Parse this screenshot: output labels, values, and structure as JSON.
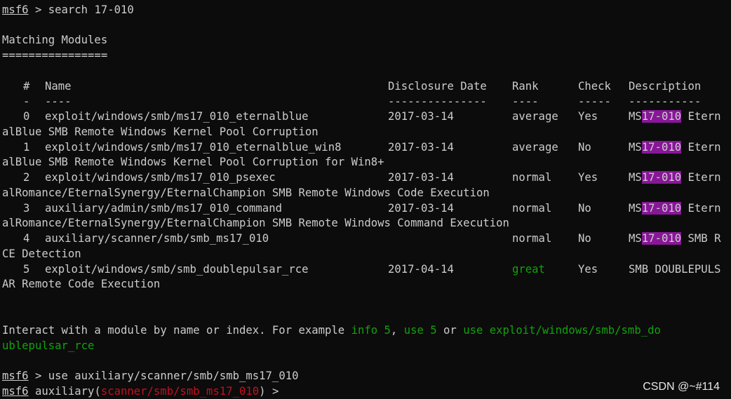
{
  "prompt": {
    "label": "msf6",
    "sep": " > "
  },
  "cmd1": "search 17-010",
  "heading": "Matching Modules",
  "underline": "================",
  "columns": {
    "num": "#",
    "name": "Name",
    "date": "Disclosure Date",
    "rank": "Rank",
    "check": "Check",
    "desc": "Description"
  },
  "dashes": {
    "num": "-",
    "name": "----",
    "date": "---------------",
    "rank": "----",
    "check": "-----",
    "desc": "-----------"
  },
  "modules": [
    {
      "num": "0",
      "name": "exploit/windows/smb/ms17_010_eternalblue",
      "date": "2017-03-14",
      "rank": "average",
      "check": "Yes",
      "desc_pre": "MS",
      "desc_hl": "17-010",
      "desc_post": " Etern",
      "wrap": "alBlue SMB Remote Windows Kernel Pool Corruption"
    },
    {
      "num": "1",
      "name": "exploit/windows/smb/ms17_010_eternalblue_win8",
      "date": "2017-03-14",
      "rank": "average",
      "check": "No",
      "desc_pre": "MS",
      "desc_hl": "17-010",
      "desc_post": " Etern",
      "wrap": "alBlue SMB Remote Windows Kernel Pool Corruption for Win8+"
    },
    {
      "num": "2",
      "name": "exploit/windows/smb/ms17_010_psexec",
      "date": "2017-03-14",
      "rank": "normal",
      "check": "Yes",
      "desc_pre": "MS",
      "desc_hl": "17-010",
      "desc_post": " Etern",
      "wrap": "alRomance/EternalSynergy/EternalChampion SMB Remote Windows Code Execution"
    },
    {
      "num": "3",
      "name": "auxiliary/admin/smb/ms17_010_command",
      "date": "2017-03-14",
      "rank": "normal",
      "check": "No",
      "desc_pre": "MS",
      "desc_hl": "17-010",
      "desc_post": " Etern",
      "wrap": "alRomance/EternalSynergy/EternalChampion SMB Remote Windows Command Execution"
    },
    {
      "num": "4",
      "name": "auxiliary/scanner/smb/smb_ms17_010",
      "date": "",
      "rank": "normal",
      "check": "No",
      "desc_pre": "MS",
      "desc_hl": "17-010",
      "desc_post": " SMB R",
      "wrap": "CE Detection"
    },
    {
      "num": "5",
      "name": "exploit/windows/smb/smb_doublepulsar_rce",
      "date": "2017-04-14",
      "rank": "great",
      "check": "Yes",
      "desc_pre": "SMB DOUBLEPULS",
      "desc_hl": "",
      "desc_post": "",
      "wrap": "AR Remote Code Execution"
    }
  ],
  "interact": {
    "prefix": "Interact with a module by name or index. For example ",
    "info": "info 5",
    "comma": ", ",
    "use": "use 5",
    "or": " or ",
    "use_full": "use exploit/windows/smb/smb_do",
    "wrap": "ublepulsar_rce"
  },
  "cmd2": "use auxiliary/scanner/smb/smb_ms17_010",
  "prompt2": {
    "mod_prefix": " auxiliary(",
    "mod_path": "scanner/smb/smb_ms17_010",
    "mod_suffix": ") >"
  },
  "watermark": "CSDN @~#114",
  "colors": {
    "background": "#0c0c0c",
    "foreground": "#cccccc",
    "red": "#c50f1f",
    "green": "#13a10e",
    "highlight": "#881798"
  }
}
